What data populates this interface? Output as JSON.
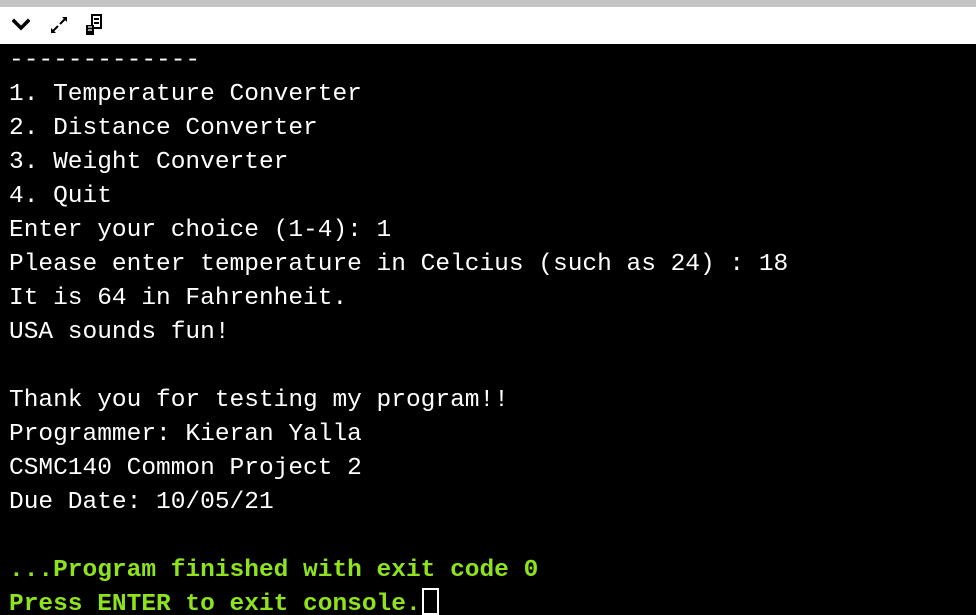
{
  "toolbar": {
    "buttons": [
      {
        "icon": "chevron-down-icon"
      },
      {
        "icon": "expand-icon"
      },
      {
        "icon": "copy-icon"
      }
    ]
  },
  "console": {
    "separator": "-------------",
    "lines": [
      "1. Temperature Converter",
      "2. Distance Converter",
      "3. Weight Converter",
      "4. Quit",
      "Enter your choice (1-4): 1",
      "Please enter temperature in Celcius (such as 24) : 18",
      "It is 64 in Fahrenheit.",
      "USA sounds fun!",
      "",
      "Thank you for testing my program!!",
      "Programmer: Kieran Yalla",
      "CSMC140 Common Project 2",
      "Due Date: 10/05/21",
      ""
    ],
    "exit_message": "...Program finished with exit code 0",
    "press_enter": "Press ENTER to exit console."
  },
  "colors": {
    "background": "#000000",
    "text": "#ffffff",
    "status_text": "#8ee31c",
    "toolbar": "#ffffff",
    "top_strip": "#c3c3c3"
  }
}
